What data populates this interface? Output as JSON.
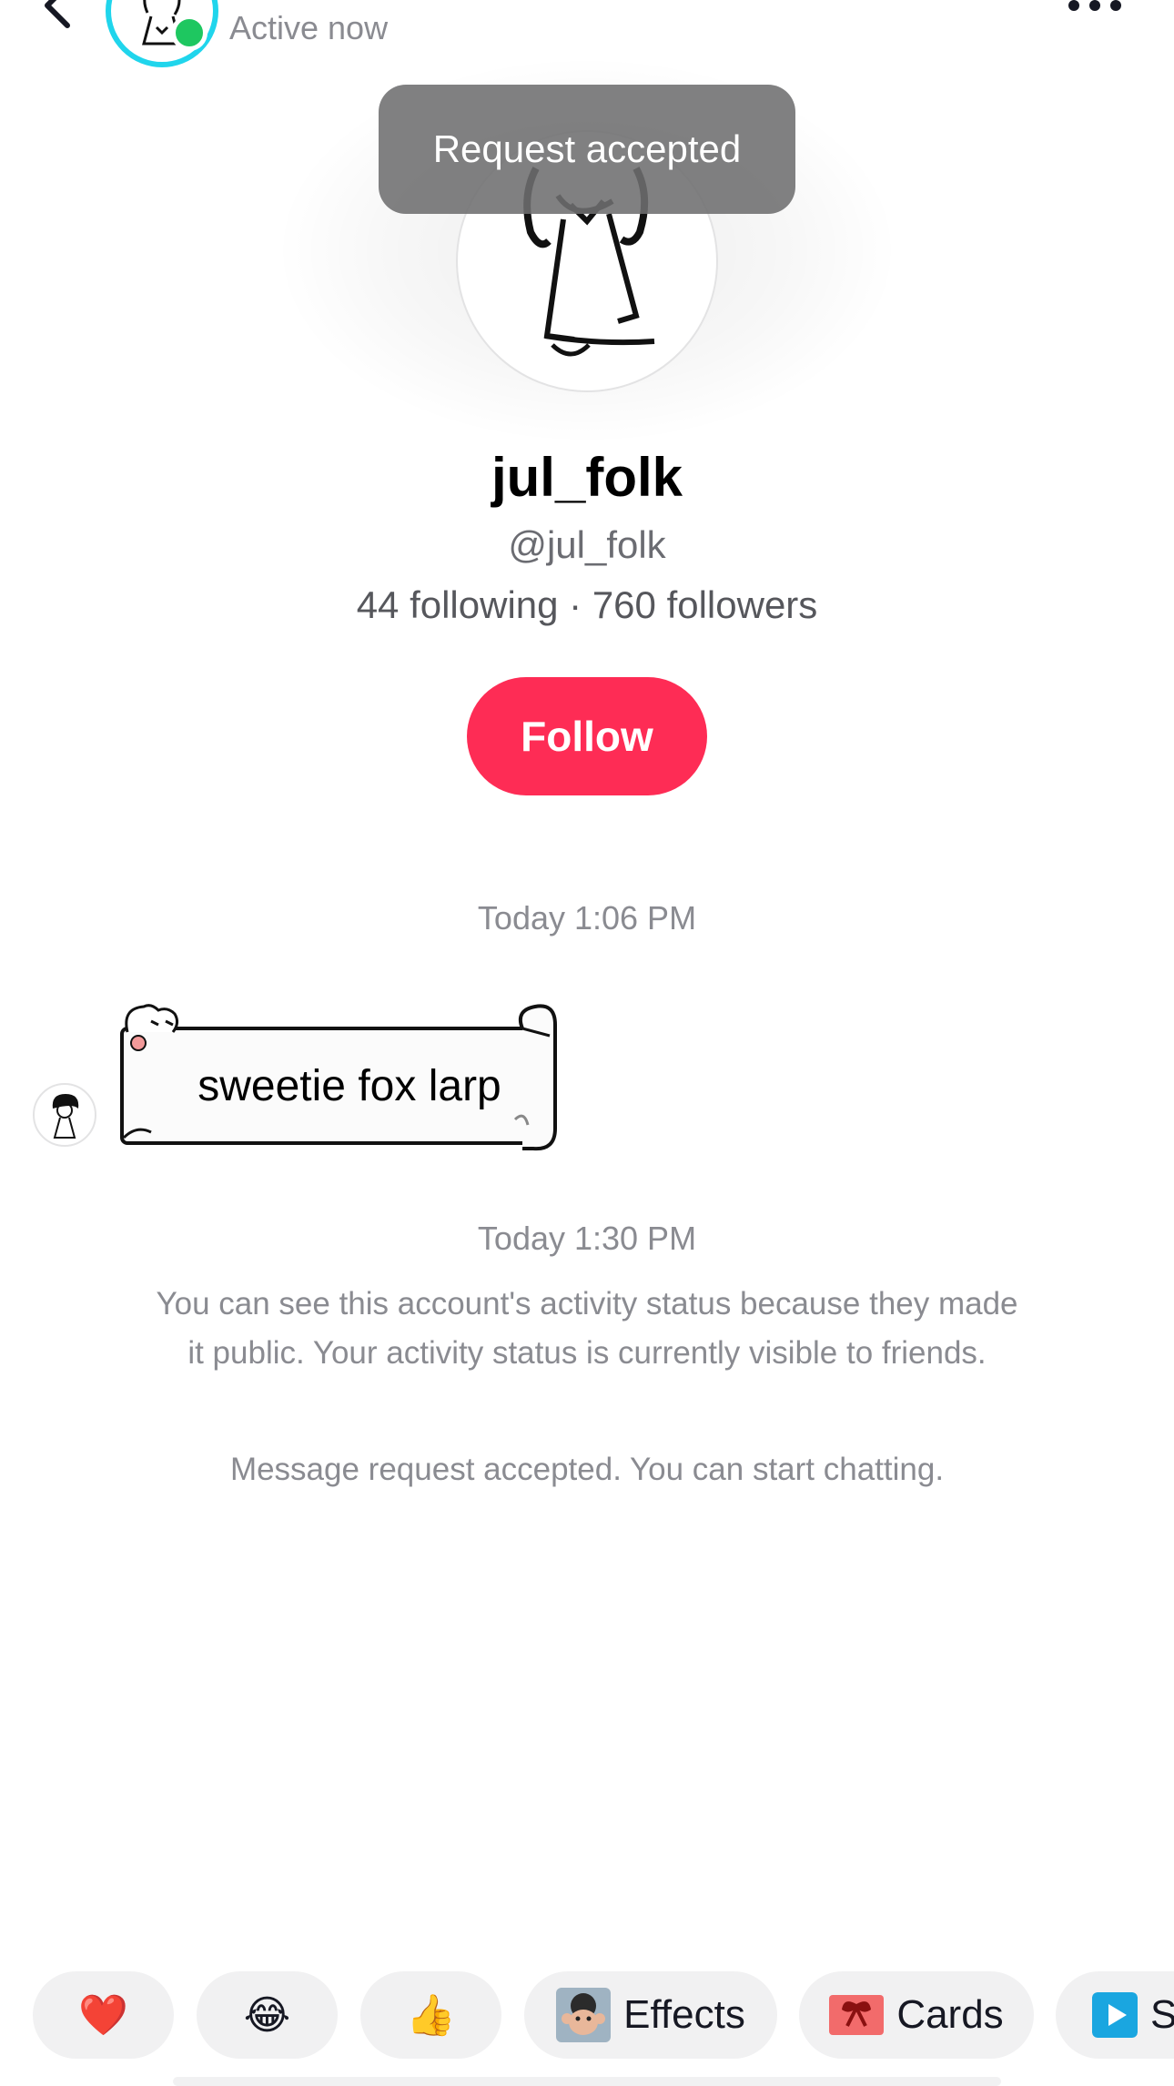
{
  "header": {
    "active_status": "Active now"
  },
  "toast": {
    "text": "Request accepted"
  },
  "profile": {
    "display_name": "jul_folk",
    "username": "@jul_folk",
    "stats": "44 following · 760 followers",
    "follow_label": "Follow"
  },
  "messages": [
    {
      "timestamp": "Today 1:06 PM",
      "sticker_text": "sweetie fox larp"
    }
  ],
  "system": {
    "timestamp": "Today 1:30 PM",
    "activity_note": "You can see this account's activity status because they made it public. Your activity status is currently visible to friends.",
    "accepted_note": "Message request accepted. You can start chatting."
  },
  "quick_replies": {
    "heart": "❤️",
    "laugh": "😂",
    "thumbs": "👍",
    "effects_label": "Effects",
    "cards_label": "Cards",
    "partial_label": "S"
  },
  "colors": {
    "accent": "#fe2c55",
    "ring": "#20d5ec",
    "online": "#1ec760"
  }
}
